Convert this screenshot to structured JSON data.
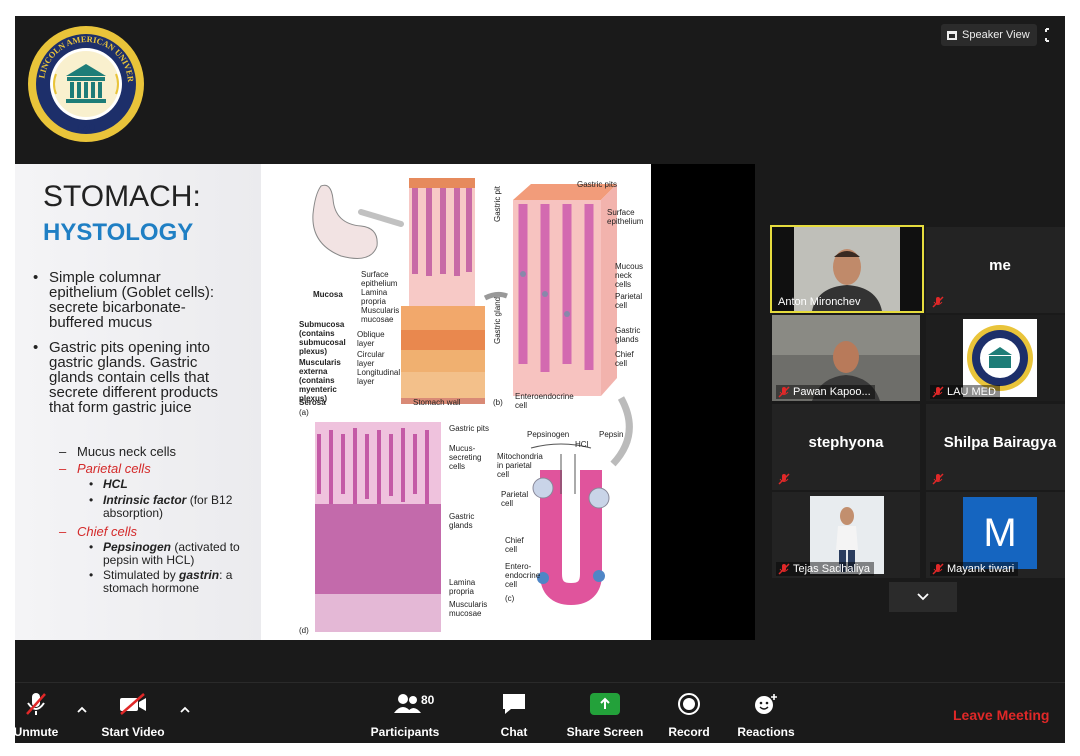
{
  "top_bar": {
    "speaker_view_label": "Speaker View",
    "speaker_view_icon": "grid-icon",
    "fullscreen_icon": "fullscreen-icon"
  },
  "logo": {
    "ring_text": "LINCOLN AMERICAN UNIVERSITY",
    "abbr": "LAU",
    "colors": {
      "gold": "#e9c43a",
      "teal": "#1e7d78",
      "navy": "#1d2f6a"
    }
  },
  "slide": {
    "title": "STOMACH:",
    "subtitle": "HYSTOLOGY",
    "bullets": [
      {
        "lines": [
          "Simple columnar",
          "epithelium (Goblet cells):",
          "secrete bicarbonate-",
          "buffered mucus"
        ]
      },
      {
        "lines": [
          "Gastric pits opening into",
          "gastric glands. Gastric",
          "glands contain cells that",
          "secrete different products",
          "that form gastric juice"
        ]
      }
    ],
    "sub_items": {
      "mucus": "Mucus neck cells",
      "parietal": "Parietal cells",
      "hcl": "HCL",
      "intrinsic_bold": "Intrinsic factor",
      "intrinsic_rest": " (for B12",
      "intrinsic_line2": "absorption)",
      "chief": "Chief cells",
      "pepsinogen_bold": "Pepsinogen",
      "pepsinogen_rest": " (activated to",
      "pepsinogen_line2": "pepsin with HCL)",
      "stimulated_pre": "Stimulated by ",
      "stimulated_bold": "gastrin",
      "stimulated_post": ": a",
      "stimulated_line2": "stomach hormone"
    },
    "diagram_labels": {
      "gastric_pits_top": "Gastric pits",
      "surface_epithelium_b": "Surface\nepithelium",
      "gastric_pit": "Gastric pit",
      "mucous_neck_cells": "Mucous\nneck\ncells",
      "parietal_cell_b": "Parietal\ncell",
      "gastric_gland": "Gastric gland",
      "gastric_glands_b": "Gastric\nglands",
      "chief_cell_b": "Chief\ncell",
      "enteroendocrine_b": "Enteroendocrine\ncell",
      "b_tag": "(b)",
      "mucosa": "Mucosa",
      "surface_epithelium_a": "Surface\nepithelium",
      "lamina_propria_a": "Lamina\npropria",
      "muscularis_mucosae_a": "Muscularis\nmucosae",
      "submucosa": "Submucosa\n(contains\nsubmucosal\nplexus)",
      "muscularis_externa": "Muscularis\nexterna\n(contains\nmyenteric\nplexus)",
      "serosa": "Serosa",
      "oblique_layer": "Oblique\nlayer",
      "circular_layer": "Circular\nlayer",
      "longitudinal_layer": "Longitudinal\nlayer",
      "a_tag": "(a)",
      "stomach_wall": "Stomach wall",
      "gastric_pits_d": "Gastric pits",
      "mucus_secreting": "Mucus-\nsecreting\ncells",
      "gastric_glands_d": "Gastric\nglands",
      "lamina_propria_d": "Lamina\npropria",
      "muscularis_mucosae_d": "Muscularis\nmucosae",
      "d_tag": "(d)",
      "pepsinogen": "Pepsinogen",
      "pepsin": "Pepsin",
      "hcl": "HCl",
      "mitochondria": "Mitochondria\nin parietal\ncell",
      "parietal_cell_c": "Parietal\ncell",
      "chief_cell_c": "Chief\ncell",
      "entero_c": "Entero-\nendocrine\ncell",
      "c_tag": "(c)"
    }
  },
  "gallery": {
    "tiles": [
      {
        "name": "Anton Mironchev",
        "muted": false,
        "active_speaker": true,
        "type": "video"
      },
      {
        "name": "me",
        "muted": true,
        "type": "name"
      },
      {
        "name": "Pawan Kapoo...",
        "muted": true,
        "type": "video"
      },
      {
        "name": "LAU MED",
        "muted": true,
        "type": "logo"
      },
      {
        "name": "stephyona",
        "muted": true,
        "type": "name"
      },
      {
        "name": "Shilpa Bairagya",
        "muted": true,
        "type": "name"
      },
      {
        "name": "Tejas Sadhaliya",
        "muted": true,
        "type": "photo"
      },
      {
        "name": "Mayank tiwari",
        "muted": true,
        "type": "avatar",
        "avatar_letter": "M",
        "avatar_color": "#1565c0"
      }
    ],
    "more_icon": "chevron-down-icon"
  },
  "toolbar": {
    "unmute": "Unmute",
    "start_video": "Start Video",
    "participants": "Participants",
    "participants_count": "80",
    "chat": "Chat",
    "share_screen": "Share Screen",
    "record": "Record",
    "reactions": "Reactions",
    "leave": "Leave Meeting",
    "share_color": "#23a13a",
    "leave_color": "#e02828"
  }
}
